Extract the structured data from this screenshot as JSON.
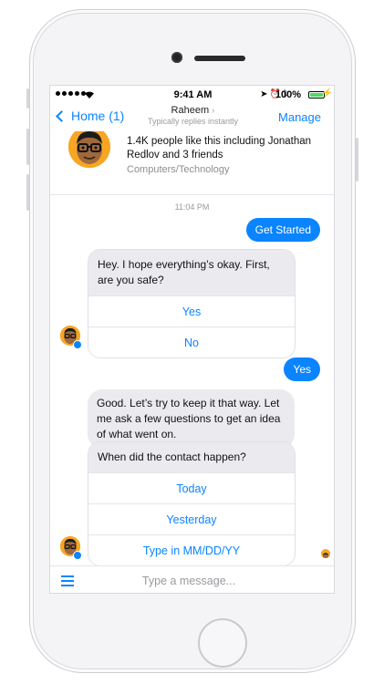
{
  "status_bar": {
    "time": "9:41 AM",
    "battery_percent": "100%",
    "battery_level": 1.0
  },
  "nav": {
    "back_label": "Home (1)",
    "title": "Raheem",
    "subtitle": "Typically replies instantly",
    "manage_label": "Manage"
  },
  "page_info": {
    "likes_text": "1.4K people like this including Jonathan Redlov and 3 friends",
    "category": "Computers/Technology"
  },
  "chat": {
    "timestamp": "11:04 PM",
    "msg_get_started": "Get Started",
    "msg_safety_question": "Hey. I hope everything’s okay. First, are you safe?",
    "quick_replies_safety": [
      "Yes",
      "No"
    ],
    "msg_yes": "Yes",
    "msg_good": "Good. Let’s try to keep it that way. Let me ask a few questions to get an idea of what went on.",
    "msg_contact_question": "When did the contact happen?",
    "quick_replies_date": [
      "Today",
      "Yesterday",
      "Type in MM/DD/YY"
    ]
  },
  "composer": {
    "placeholder": "Type a message..."
  },
  "colors": {
    "accent": "#0a84ff",
    "bubble_incoming": "#ebebef",
    "avatar_bg": "#f6a623",
    "battery_fill": "#4cd964"
  },
  "icons": [
    "signal-dots-icon",
    "wifi-icon",
    "location-icon",
    "alarm-icon",
    "bluetooth-icon",
    "battery-icon",
    "charging-icon",
    "chevron-left-icon",
    "chevron-right-icon",
    "messenger-badge-icon",
    "menu-icon"
  ]
}
